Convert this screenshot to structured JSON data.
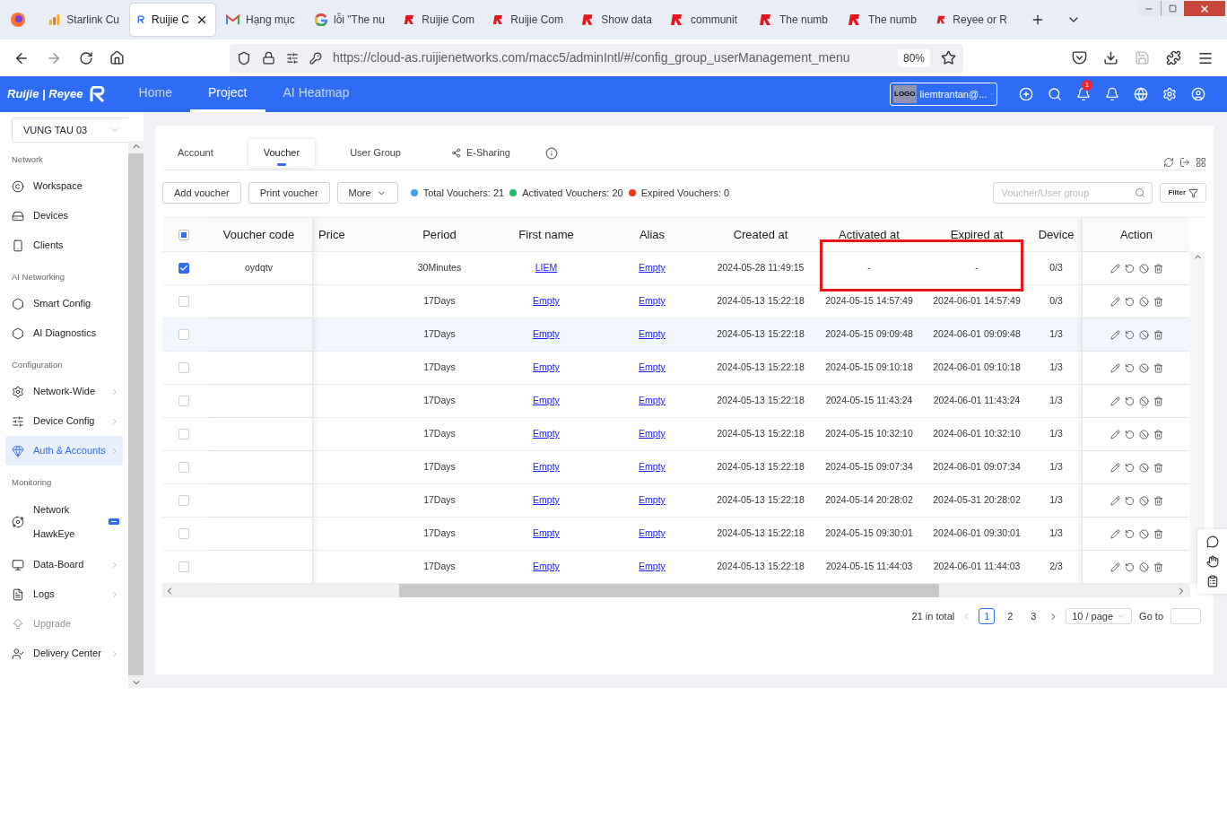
{
  "browser": {
    "tabs": [
      {
        "label": "Starlink Cu",
        "kind": "chart",
        "selected": false
      },
      {
        "label": "Ruijie C",
        "kind": "ruijie",
        "selected": true
      },
      {
        "label": "Hạng mục",
        "kind": "mail",
        "selected": false
      },
      {
        "label": "lỗi \"The nu",
        "kind": "google",
        "selected": false
      },
      {
        "label": "Ruijie Com",
        "kind": "reyee",
        "selected": false
      },
      {
        "label": "Ruijie Com",
        "kind": "reyee",
        "selected": false
      },
      {
        "label": "Show data",
        "kind": "reyee",
        "selected": false
      },
      {
        "label": "communit",
        "kind": "reyee",
        "selected": false
      },
      {
        "label": "The numb",
        "kind": "reyee",
        "selected": false
      },
      {
        "label": "The numb",
        "kind": "reyee",
        "selected": false
      },
      {
        "label": "Reyee or R",
        "kind": "reyee",
        "selected": false
      }
    ],
    "url": "https://cloud-as.ruijienetworks.com/macc5/adminIntl/#/config_group_userManagement_menu",
    "zoom": "80%"
  },
  "app_header": {
    "logo": "Ruijie | Reyee",
    "nav": [
      {
        "label": "Home",
        "selected": false
      },
      {
        "label": "Project",
        "selected": true
      },
      {
        "label": "AI Heatmap",
        "selected": false
      }
    ],
    "account": {
      "logo": "LOGO",
      "name": "liemtrantan@..."
    },
    "notification_count": "1"
  },
  "sidebar": {
    "project": "VUNG TAU 03",
    "sections": [
      {
        "title": "Network",
        "items": [
          {
            "label": "Workspace",
            "selected": false,
            "disabled": false,
            "has_submenu": false,
            "beta": false
          },
          {
            "label": "Devices",
            "selected": false,
            "disabled": false,
            "has_submenu": false,
            "beta": false
          },
          {
            "label": "Clients",
            "selected": false,
            "disabled": false,
            "has_submenu": false,
            "beta": false
          }
        ]
      },
      {
        "title": "AI Networking",
        "items": [
          {
            "label": "Smart Config",
            "selected": false,
            "disabled": false,
            "has_submenu": false,
            "beta": false
          },
          {
            "label": "AI Diagnostics",
            "selected": false,
            "disabled": false,
            "has_submenu": false,
            "beta": false
          }
        ]
      },
      {
        "title": "Configuration",
        "items": [
          {
            "label": "Network-Wide",
            "selected": false,
            "disabled": false,
            "has_submenu": true,
            "beta": false
          },
          {
            "label": "Device Config",
            "selected": false,
            "disabled": false,
            "has_submenu": true,
            "beta": false
          },
          {
            "label": "Auth & Accounts",
            "selected": true,
            "disabled": false,
            "has_submenu": true,
            "beta": false
          }
        ]
      },
      {
        "title": "Monitoring",
        "items": [
          {
            "label": "Network HawkEye",
            "selected": false,
            "disabled": false,
            "has_submenu": false,
            "beta": true
          },
          {
            "label": "Data-Board",
            "selected": false,
            "disabled": false,
            "has_submenu": true,
            "beta": false
          },
          {
            "label": "Logs",
            "selected": false,
            "disabled": false,
            "has_submenu": true,
            "beta": false
          },
          {
            "label": "Upgrade",
            "selected": false,
            "disabled": true,
            "has_submenu": false,
            "beta": false
          },
          {
            "label": "Delivery Center",
            "selected": false,
            "disabled": false,
            "has_submenu": true,
            "beta": false
          }
        ]
      }
    ]
  },
  "content_tabs": [
    {
      "label": "Account",
      "kind": "plain",
      "selected": false
    },
    {
      "label": "Voucher",
      "kind": "plain",
      "selected": true
    },
    {
      "label": "User Group",
      "kind": "plain",
      "selected": false
    },
    {
      "label": "E-Sharing",
      "kind": "share",
      "selected": false
    }
  ],
  "toolbar": {
    "buttons": [
      {
        "label": "Add voucher",
        "kind": "plain"
      },
      {
        "label": "Print voucher",
        "kind": "plain"
      },
      {
        "label": "More",
        "kind": "dropdown"
      }
    ],
    "stats": [
      {
        "label": "Total Vouchers: 21",
        "color": "#3ba4f6"
      },
      {
        "label": "Activated Vouchers: 20",
        "color": "#19be6b"
      },
      {
        "label": "Expired Vouchers: 0",
        "color": "#f5361d"
      }
    ],
    "search": {
      "placeholder": "Voucher/User group"
    },
    "filter": "Filter"
  },
  "table": {
    "header_checkbox": {
      "indeterminate": true
    },
    "columns": [
      "Voucher code",
      "Price",
      "Period",
      "First name",
      "Alias",
      "Created at",
      "Activated at",
      "Expired at",
      "Device",
      "Action"
    ],
    "rows": [
      {
        "checked": true,
        "highlighted": false,
        "voucher_code": "oydqtv",
        "period": "30Minutes",
        "first_name": "LIEM",
        "alias": "Empty",
        "created_at": "2024-05-28 11:49:15",
        "activated_at": "-",
        "expired_at": "-",
        "device": "0/3"
      },
      {
        "checked": false,
        "highlighted": false,
        "period": "17Days",
        "first_name": "Empty",
        "alias": "Empty",
        "created_at": "2024-05-13 15:22:18",
        "activated_at": "2024-05-15 14:57:49",
        "expired_at": "2024-06-01 14:57:49",
        "device": "0/3"
      },
      {
        "checked": false,
        "highlighted": true,
        "period": "17Days",
        "first_name": "Empty",
        "alias": "Empty",
        "created_at": "2024-05-13 15:22:18",
        "activated_at": "2024-05-15 09:09:48",
        "expired_at": "2024-06-01 09:09:48",
        "device": "1/3"
      },
      {
        "checked": false,
        "highlighted": false,
        "period": "17Days",
        "first_name": "Empty",
        "alias": "Empty",
        "created_at": "2024-05-13 15:22:18",
        "activated_at": "2024-05-15 09:10:18",
        "expired_at": "2024-06-01 09:10:18",
        "device": "1/3"
      },
      {
        "checked": false,
        "highlighted": false,
        "period": "17Days",
        "first_name": "Empty",
        "alias": "Empty",
        "created_at": "2024-05-13 15:22:18",
        "activated_at": "2024-05-15 11:43:24",
        "expired_at": "2024-06-01 11:43:24",
        "device": "1/3"
      },
      {
        "checked": false,
        "highlighted": false,
        "period": "17Days",
        "first_name": "Empty",
        "alias": "Empty",
        "created_at": "2024-05-13 15:22:18",
        "activated_at": "2024-05-15 10:32:10",
        "expired_at": "2024-06-01 10:32:10",
        "device": "1/3"
      },
      {
        "checked": false,
        "highlighted": false,
        "period": "17Days",
        "first_name": "Empty",
        "alias": "Empty",
        "created_at": "2024-05-13 15:22:18",
        "activated_at": "2024-05-15 09:07:34",
        "expired_at": "2024-06-01 09:07:34",
        "device": "1/3"
      },
      {
        "checked": false,
        "highlighted": false,
        "period": "17Days",
        "first_name": "Empty",
        "alias": "Empty",
        "created_at": "2024-05-13 15:22:18",
        "activated_at": "2024-05-14 20:28:02",
        "expired_at": "2024-05-31 20:28:02",
        "device": "1/3"
      },
      {
        "checked": false,
        "highlighted": false,
        "period": "17Days",
        "first_name": "Empty",
        "alias": "Empty",
        "created_at": "2024-05-13 15:22:18",
        "activated_at": "2024-05-15 09:30:01",
        "expired_at": "2024-06-01 09:30:01",
        "device": "1/3"
      },
      {
        "checked": false,
        "highlighted": false,
        "period": "17Days",
        "first_name": "Empty",
        "alias": "Empty",
        "created_at": "2024-05-13 15:22:18",
        "activated_at": "2024-05-15 11:44:03",
        "expired_at": "2024-06-01 11:44:03",
        "device": "2/3"
      }
    ]
  },
  "pagination": {
    "total": "21 in total",
    "pages": [
      {
        "label": "1",
        "selected": true
      },
      {
        "label": "2",
        "selected": false
      },
      {
        "label": "3",
        "selected": false
      }
    ],
    "page_size": "10 / page",
    "goto": "Go to"
  }
}
